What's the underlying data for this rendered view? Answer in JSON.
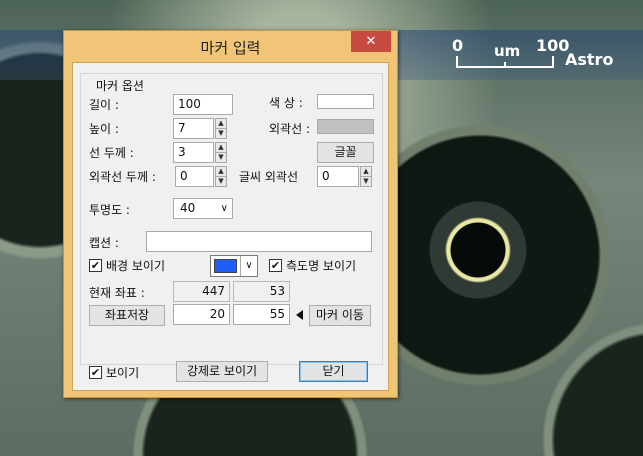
{
  "background": {
    "scale_zero": "0",
    "scale_unit": "um",
    "scale_max": "100",
    "brand": "Astro"
  },
  "dialog": {
    "title": "마커 입력",
    "close_glyph": "✕",
    "group_title": "마커 옵션",
    "length_label": "길이 :",
    "length_value": "100",
    "height_label": "높이 :",
    "height_value": "7",
    "line_thickness_label": "선 두께 :",
    "line_thickness_value": "3",
    "outline_thickness_label": "외곽선 두께 :",
    "outline_thickness_value": "0",
    "text_outline_label": "글씨 외곽선",
    "text_outline_value": "0",
    "color_label": "색  상 :",
    "color_value": "#ffffff",
    "outline_label": "외곽선 :",
    "outline_color": "#c0c0c0",
    "font_button": "글꼴",
    "opacity_label": "투명도 :",
    "opacity_value": "40",
    "caption_label": "캡션 :",
    "caption_value": "",
    "show_background_label": "배경 보이기",
    "show_background_checked": true,
    "background_color": "#1e5ef7",
    "show_scale_name_label": "측도명 보이기",
    "show_scale_name_checked": true,
    "current_coord_label": "현재 좌표 :",
    "current_x": "447",
    "current_y": "53",
    "save_coord_button": "좌표저장",
    "saved_x": "20",
    "saved_y": "55",
    "move_marker_button": "마커 이동",
    "show_label": "보이기",
    "show_checked": true,
    "force_show_button": "강제로 보이기",
    "close_button": "닫기",
    "checkmark": "✔",
    "up_arrow": "▲",
    "down_arrow": "▼",
    "dropdown_arrow": "∨"
  }
}
